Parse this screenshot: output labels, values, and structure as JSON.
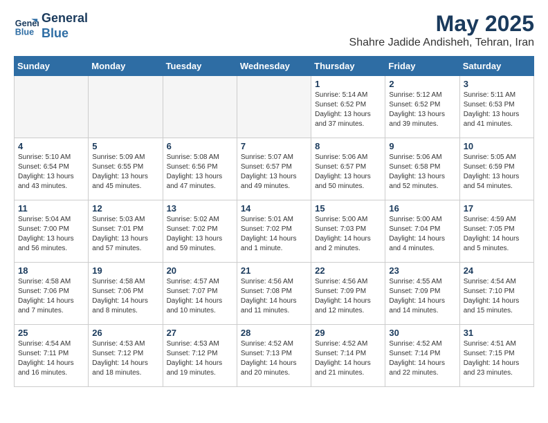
{
  "header": {
    "logo_line1": "General",
    "logo_line2": "Blue",
    "title": "May 2025",
    "subtitle": "Shahre Jadide Andisheh, Tehran, Iran"
  },
  "weekdays": [
    "Sunday",
    "Monday",
    "Tuesday",
    "Wednesday",
    "Thursday",
    "Friday",
    "Saturday"
  ],
  "weeks": [
    [
      {
        "day": "",
        "info": ""
      },
      {
        "day": "",
        "info": ""
      },
      {
        "day": "",
        "info": ""
      },
      {
        "day": "",
        "info": ""
      },
      {
        "day": "1",
        "info": "Sunrise: 5:14 AM\nSunset: 6:52 PM\nDaylight: 13 hours\nand 37 minutes."
      },
      {
        "day": "2",
        "info": "Sunrise: 5:12 AM\nSunset: 6:52 PM\nDaylight: 13 hours\nand 39 minutes."
      },
      {
        "day": "3",
        "info": "Sunrise: 5:11 AM\nSunset: 6:53 PM\nDaylight: 13 hours\nand 41 minutes."
      }
    ],
    [
      {
        "day": "4",
        "info": "Sunrise: 5:10 AM\nSunset: 6:54 PM\nDaylight: 13 hours\nand 43 minutes."
      },
      {
        "day": "5",
        "info": "Sunrise: 5:09 AM\nSunset: 6:55 PM\nDaylight: 13 hours\nand 45 minutes."
      },
      {
        "day": "6",
        "info": "Sunrise: 5:08 AM\nSunset: 6:56 PM\nDaylight: 13 hours\nand 47 minutes."
      },
      {
        "day": "7",
        "info": "Sunrise: 5:07 AM\nSunset: 6:57 PM\nDaylight: 13 hours\nand 49 minutes."
      },
      {
        "day": "8",
        "info": "Sunrise: 5:06 AM\nSunset: 6:57 PM\nDaylight: 13 hours\nand 50 minutes."
      },
      {
        "day": "9",
        "info": "Sunrise: 5:06 AM\nSunset: 6:58 PM\nDaylight: 13 hours\nand 52 minutes."
      },
      {
        "day": "10",
        "info": "Sunrise: 5:05 AM\nSunset: 6:59 PM\nDaylight: 13 hours\nand 54 minutes."
      }
    ],
    [
      {
        "day": "11",
        "info": "Sunrise: 5:04 AM\nSunset: 7:00 PM\nDaylight: 13 hours\nand 56 minutes."
      },
      {
        "day": "12",
        "info": "Sunrise: 5:03 AM\nSunset: 7:01 PM\nDaylight: 13 hours\nand 57 minutes."
      },
      {
        "day": "13",
        "info": "Sunrise: 5:02 AM\nSunset: 7:02 PM\nDaylight: 13 hours\nand 59 minutes."
      },
      {
        "day": "14",
        "info": "Sunrise: 5:01 AM\nSunset: 7:02 PM\nDaylight: 14 hours\nand 1 minute."
      },
      {
        "day": "15",
        "info": "Sunrise: 5:00 AM\nSunset: 7:03 PM\nDaylight: 14 hours\nand 2 minutes."
      },
      {
        "day": "16",
        "info": "Sunrise: 5:00 AM\nSunset: 7:04 PM\nDaylight: 14 hours\nand 4 minutes."
      },
      {
        "day": "17",
        "info": "Sunrise: 4:59 AM\nSunset: 7:05 PM\nDaylight: 14 hours\nand 5 minutes."
      }
    ],
    [
      {
        "day": "18",
        "info": "Sunrise: 4:58 AM\nSunset: 7:06 PM\nDaylight: 14 hours\nand 7 minutes."
      },
      {
        "day": "19",
        "info": "Sunrise: 4:58 AM\nSunset: 7:06 PM\nDaylight: 14 hours\nand 8 minutes."
      },
      {
        "day": "20",
        "info": "Sunrise: 4:57 AM\nSunset: 7:07 PM\nDaylight: 14 hours\nand 10 minutes."
      },
      {
        "day": "21",
        "info": "Sunrise: 4:56 AM\nSunset: 7:08 PM\nDaylight: 14 hours\nand 11 minutes."
      },
      {
        "day": "22",
        "info": "Sunrise: 4:56 AM\nSunset: 7:09 PM\nDaylight: 14 hours\nand 12 minutes."
      },
      {
        "day": "23",
        "info": "Sunrise: 4:55 AM\nSunset: 7:09 PM\nDaylight: 14 hours\nand 14 minutes."
      },
      {
        "day": "24",
        "info": "Sunrise: 4:54 AM\nSunset: 7:10 PM\nDaylight: 14 hours\nand 15 minutes."
      }
    ],
    [
      {
        "day": "25",
        "info": "Sunrise: 4:54 AM\nSunset: 7:11 PM\nDaylight: 14 hours\nand 16 minutes."
      },
      {
        "day": "26",
        "info": "Sunrise: 4:53 AM\nSunset: 7:12 PM\nDaylight: 14 hours\nand 18 minutes."
      },
      {
        "day": "27",
        "info": "Sunrise: 4:53 AM\nSunset: 7:12 PM\nDaylight: 14 hours\nand 19 minutes."
      },
      {
        "day": "28",
        "info": "Sunrise: 4:52 AM\nSunset: 7:13 PM\nDaylight: 14 hours\nand 20 minutes."
      },
      {
        "day": "29",
        "info": "Sunrise: 4:52 AM\nSunset: 7:14 PM\nDaylight: 14 hours\nand 21 minutes."
      },
      {
        "day": "30",
        "info": "Sunrise: 4:52 AM\nSunset: 7:14 PM\nDaylight: 14 hours\nand 22 minutes."
      },
      {
        "day": "31",
        "info": "Sunrise: 4:51 AM\nSunset: 7:15 PM\nDaylight: 14 hours\nand 23 minutes."
      }
    ]
  ]
}
